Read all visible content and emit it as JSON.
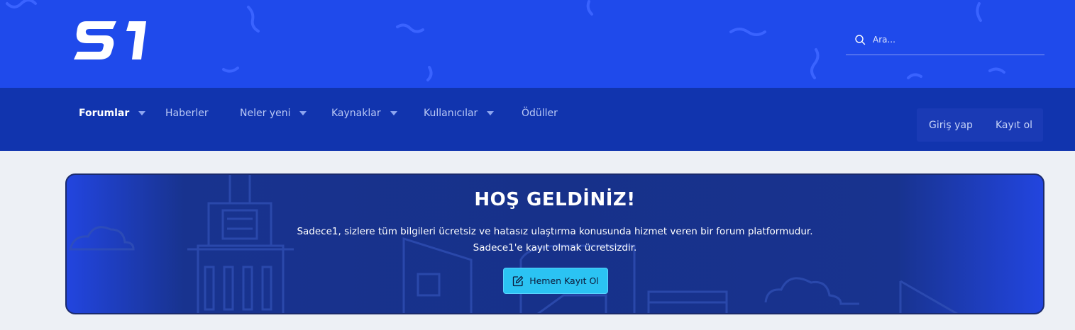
{
  "header": {
    "logo_text": "S1",
    "search": {
      "placeholder": "Ara..."
    }
  },
  "nav": {
    "items": [
      {
        "label": "Forumlar",
        "has_dropdown": true,
        "active": true
      },
      {
        "label": "Haberler",
        "has_dropdown": false
      },
      {
        "label": "Neler yeni",
        "has_dropdown": true
      },
      {
        "label": "Kaynaklar",
        "has_dropdown": true
      },
      {
        "label": "Kullanıcılar",
        "has_dropdown": true
      },
      {
        "label": "Ödüller",
        "has_dropdown": false
      }
    ],
    "login_label": "Giriş yap",
    "register_label": "Kayıt ol"
  },
  "banner": {
    "title": "HOŞ GELDİNİZ!",
    "line1": "Sadece1, sizlere tüm bilgileri ücretsiz ve hatasız ulaştırma konusunda hizmet veren bir forum platformudur.",
    "line2": "Sadece1'e kayıt olmak ücretsizdir.",
    "cta_label": "Hemen Kayıt Ol"
  },
  "colors": {
    "header_bg": "#1f4aeb",
    "nav_bg": "#1134ae",
    "banner_bg": "#17318a",
    "cta_bg": "#2bc3f3",
    "page_bg": "#edf0f5"
  },
  "icons": [
    "logo",
    "search-icon",
    "chevron-down-icon",
    "edit-icon"
  ]
}
